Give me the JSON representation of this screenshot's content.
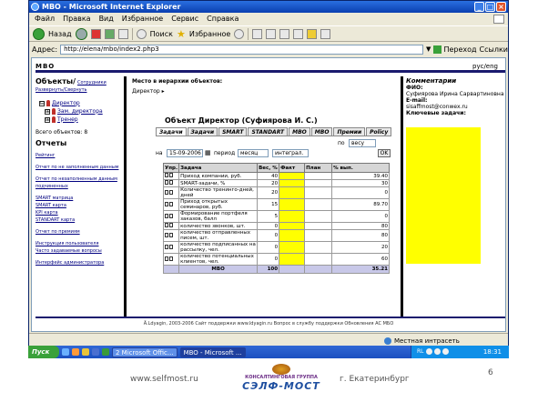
{
  "window": {
    "title": "MBO - Microsoft Internet Explorer",
    "menu": [
      "Файл",
      "Правка",
      "Вид",
      "Избранное",
      "Сервис",
      "Справка"
    ],
    "toolbar": {
      "back": "Назад",
      "search": "Поиск",
      "favorites": "Избранное"
    },
    "address_label": "Адрес:",
    "address_value": "http://elena/mbo/index2.php3",
    "go_label": "Переход",
    "links_label": "Ссылки",
    "status_zone": "Местная интрасеть"
  },
  "site": {
    "logo": "MBO",
    "lang": "рус/eng",
    "footer": "Ä.Ldyagin, 2003-2006   Сайт поддержки www.ldyagin.ru   Вопрос в службу поддержки   Обновления АС МБО"
  },
  "left": {
    "objects_title": "Объекты/",
    "employees_link": "Сотрудники",
    "expand": "Развернуть/Свернуть",
    "tree": [
      {
        "label": "Директор",
        "level": 0,
        "sign": "⊟"
      },
      {
        "label": "Зам. директора",
        "level": 1,
        "sign": "⊞"
      },
      {
        "label": "Тренер",
        "level": 1,
        "sign": "⊞"
      }
    ],
    "total_objects": "Всего объектов: 8",
    "reports_title": "Отчеты",
    "links": [
      {
        "label": "Рейтинг",
        "gap": true
      },
      {
        "label": "Отчет по не заполненным данным",
        "gap": true
      },
      {
        "label": "Отчет по незаполненным данным подчиненных",
        "gap": true
      },
      {
        "label": "SMART матрица",
        "gap": true
      },
      {
        "label": "SMART карта",
        "gap": false
      },
      {
        "label": "KPI карта",
        "gap": false
      },
      {
        "label": "STANDART карта",
        "gap": false
      },
      {
        "label": "Отчет по премиям",
        "gap": true
      },
      {
        "label": "Инструкция пользователя",
        "gap": true
      },
      {
        "label": "Часто задаваемые вопросы",
        "gap": false
      },
      {
        "label": "Интерфейс администратора",
        "gap": true
      }
    ]
  },
  "center": {
    "breadcrumb_title": "Место в иерархии объектов:",
    "breadcrumb_item": "Директор ▸",
    "object_heading": "Объект  Директор  (Суфиярова И. С.)",
    "tabs": [
      "Задачи",
      "Задачи",
      "SMART",
      "STANDART",
      "MBO",
      "MBO",
      "Премии",
      "Policy"
    ],
    "filter": {
      "on_label": "на",
      "date": "15-09-2006",
      "period_label": "период",
      "period_value": "месяц",
      "period2_value": "интеграл.",
      "by_label": "по",
      "weight_value": "весу",
      "ok": "OK"
    },
    "table": {
      "headers": [
        "Упр.",
        "Задача",
        "Вес, %",
        "Факт",
        "План",
        "% вып."
      ],
      "rows": [
        {
          "task": "Приход компании, руб.",
          "weight": "40",
          "plan": "",
          "pct": "39.40"
        },
        {
          "task": "SMART-задачи, %",
          "weight": "20",
          "plan": "",
          "pct": "30"
        },
        {
          "task": "Количество тренинго-дней, дней",
          "weight": "20",
          "plan": "",
          "pct": "0"
        },
        {
          "task": "Приход открытых семинаров, руб.",
          "weight": "15",
          "plan": "",
          "pct": "89.70"
        },
        {
          "task": "Формирование портфеля заказов, балл",
          "weight": "5",
          "plan": "",
          "pct": "0"
        },
        {
          "task": "количество звонков, шт.",
          "weight": "0",
          "plan": "",
          "pct": "80"
        },
        {
          "task": "количество отправленных писем, шт.",
          "weight": "0",
          "plan": "",
          "pct": "80"
        },
        {
          "task": "количество подписанных на рассылку, чел.",
          "weight": "0",
          "plan": "",
          "pct": "20"
        },
        {
          "task": "количество потенциальных клиентов, чел.",
          "weight": "0",
          "plan": "",
          "pct": "60"
        }
      ],
      "total": {
        "label": "МВО",
        "weight": "100",
        "pct": "35.21"
      }
    }
  },
  "right": {
    "title": "Комментарии",
    "fio_label": "ФИО:",
    "fio_value": "Суфиярова Ирина Сарвартиновна",
    "email_label": "E-mail:",
    "email_value": "sisaffmost@conwex.ru",
    "key_tasks": "Ключевые задачи:"
  },
  "taskbar": {
    "start": "Пуск",
    "tasks": [
      "2 Microsoft Offic...",
      "MBO - Microsoft ..."
    ],
    "lang": "RL",
    "time": "18:31"
  },
  "slide": {
    "url": "www.selfmost.ru",
    "brand_top": "КОНСАЛТИНГОВАЯ ГРУППА",
    "brand_name": "СЭЛФ-МОСТ",
    "city": "г. Екатеринбург",
    "page": "6"
  }
}
